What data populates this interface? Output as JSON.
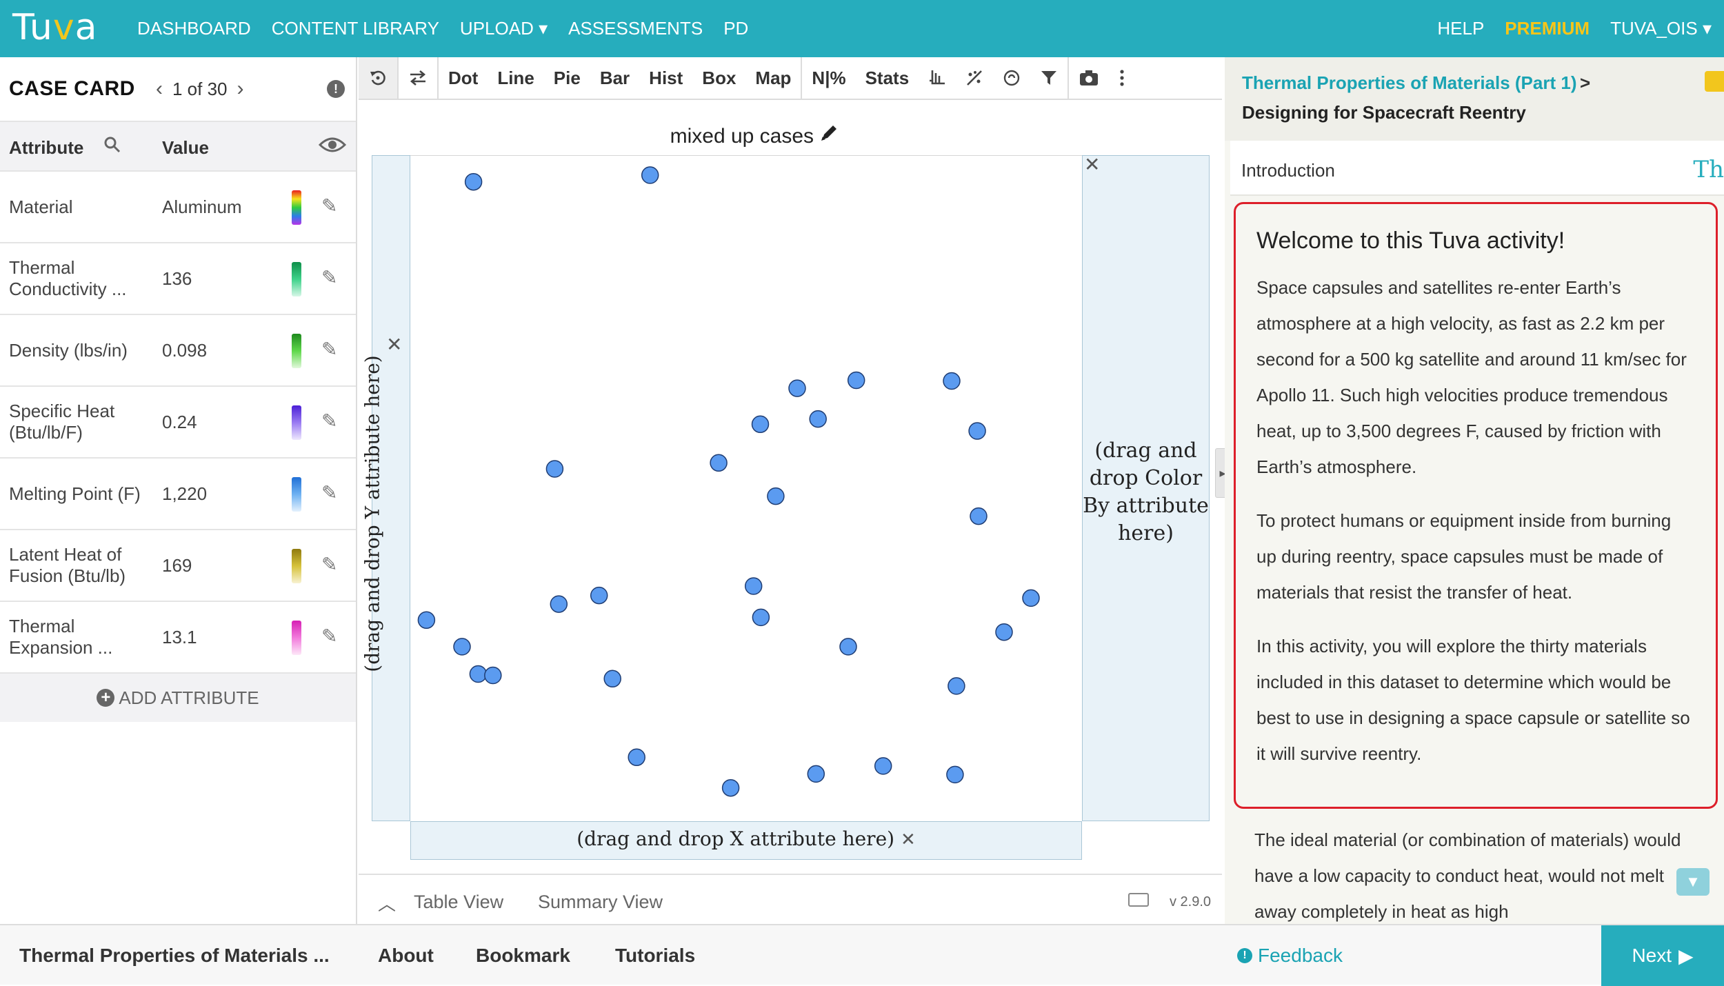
{
  "nav": {
    "logo_pre": "Tu",
    "logo_v": "v",
    "logo_post": "a",
    "left": [
      "DASHBOARD",
      "CONTENT LIBRARY",
      "UPLOAD ▾",
      "ASSESSMENTS",
      "PD"
    ],
    "help": "HELP",
    "premium": "PREMIUM",
    "user": "TUVA_OIS ▾"
  },
  "case_card": {
    "title": "CASE CARD",
    "position": "1 of 30",
    "col_attribute": "Attribute",
    "col_value": "Value",
    "rows": [
      {
        "attribute": "Material",
        "value": "Aluminum",
        "swatch": "linear-gradient(#e91e1e,#f7e31c,#2ecc40,#2d7de8,#b833e8)"
      },
      {
        "attribute": "Thermal Conductivity ...",
        "value": "136",
        "swatch": "linear-gradient(#0e8f4a,#3fd28a,#d8f7e8)"
      },
      {
        "attribute": "Density (lbs/in)",
        "value": "0.098",
        "swatch": "linear-gradient(#1e8a1e,#5fd84a,#e2f8dc)"
      },
      {
        "attribute": "Specific Heat (Btu/lb/F)",
        "value": "0.24",
        "swatch": "linear-gradient(#4b1fd6,#9a7bf2,#eee8fd)"
      },
      {
        "attribute": "Melting Point (F)",
        "value": "1,220",
        "swatch": "linear-gradient(#1f6fd6,#6fb2f2,#e4f1fd)"
      },
      {
        "attribute": "Latent Heat of Fusion (Btu/lb)",
        "value": "169",
        "swatch": "linear-gradient(#8f7a0e,#d6c23a,#f8f2d2)"
      },
      {
        "attribute": "Thermal Expansion ...",
        "value": "13.1",
        "swatch": "linear-gradient(#d61fb4,#f27bdc,#fde8f8)"
      }
    ],
    "add_attribute": "ADD ATTRIBUTE"
  },
  "toolbar": {
    "buttons": [
      "Dot",
      "Line",
      "Pie",
      "Bar",
      "Hist",
      "Box",
      "Map",
      "N|%",
      "Stats"
    ]
  },
  "graph": {
    "title": "mixed up cases",
    "y_placeholder": "(drag and drop Y attribute here)",
    "x_placeholder": "(drag and drop X attribute here)",
    "color_placeholder": "(drag and drop Color By attribute here)",
    "point_color": "#5b9bf0",
    "table_view": "Table View",
    "summary_view": "Summary View",
    "version": "v 2.9.0"
  },
  "chart_data": {
    "type": "scatter",
    "title": "mixed up cases",
    "xlabel": "",
    "ylabel": "",
    "xlim": [
      0,
      1
    ],
    "ylim": [
      0,
      1
    ],
    "points": [
      {
        "x": 0.094,
        "y": 0.961
      },
      {
        "x": 0.357,
        "y": 0.971
      },
      {
        "x": 0.215,
        "y": 0.53
      },
      {
        "x": 0.459,
        "y": 0.539
      },
      {
        "x": 0.521,
        "y": 0.597
      },
      {
        "x": 0.576,
        "y": 0.651
      },
      {
        "x": 0.607,
        "y": 0.605
      },
      {
        "x": 0.664,
        "y": 0.663
      },
      {
        "x": 0.806,
        "y": 0.662
      },
      {
        "x": 0.844,
        "y": 0.587
      },
      {
        "x": 0.544,
        "y": 0.489
      },
      {
        "x": 0.846,
        "y": 0.459
      },
      {
        "x": 0.024,
        "y": 0.303
      },
      {
        "x": 0.077,
        "y": 0.263
      },
      {
        "x": 0.101,
        "y": 0.222
      },
      {
        "x": 0.123,
        "y": 0.22
      },
      {
        "x": 0.221,
        "y": 0.327
      },
      {
        "x": 0.281,
        "y": 0.34
      },
      {
        "x": 0.511,
        "y": 0.354
      },
      {
        "x": 0.522,
        "y": 0.307
      },
      {
        "x": 0.652,
        "y": 0.263
      },
      {
        "x": 0.924,
        "y": 0.336
      },
      {
        "x": 0.884,
        "y": 0.285
      },
      {
        "x": 0.301,
        "y": 0.215
      },
      {
        "x": 0.813,
        "y": 0.204
      },
      {
        "x": 0.337,
        "y": 0.097
      },
      {
        "x": 0.477,
        "y": 0.051
      },
      {
        "x": 0.604,
        "y": 0.072
      },
      {
        "x": 0.704,
        "y": 0.084
      },
      {
        "x": 0.811,
        "y": 0.071
      }
    ]
  },
  "right_panel": {
    "crumb_parent": "Thermal Properties of Materials (Part 1)",
    "crumb_sep": ">",
    "crumb_current": "Designing for Spacecraft Reentry",
    "section": "Introduction",
    "section_overflow": "Th",
    "heading": "Welcome to this Tuva activity!",
    "p1": "Space capsules and satellites re-enter Earth’s atmosphere at a high velocity, as fast as 2.2 km per second for a 500 kg satellite and around 11 km/sec for Apollo 11. Such high velocities produce tremendous heat, up to 3,500 degrees F, caused by friction with Earth’s atmosphere.",
    "p2": "To protect humans or equipment inside from burning up during reentry, space capsules must be made of materials that resist the transfer of heat.",
    "p3": "In this activity, you will explore the thirty materials included in this dataset to determine which would be best to use in designing a space capsule or satellite so it will survive reentry.",
    "p4": "The ideal material (or combination of materials) would have a low capacity to conduct heat, would not melt away completely in heat as high"
  },
  "bottom": {
    "title": "Thermal Properties of Materials ...",
    "about": "About",
    "bookmark": "Bookmark",
    "tutorials": "Tutorials",
    "feedback": "Feedback",
    "next": "Next"
  }
}
